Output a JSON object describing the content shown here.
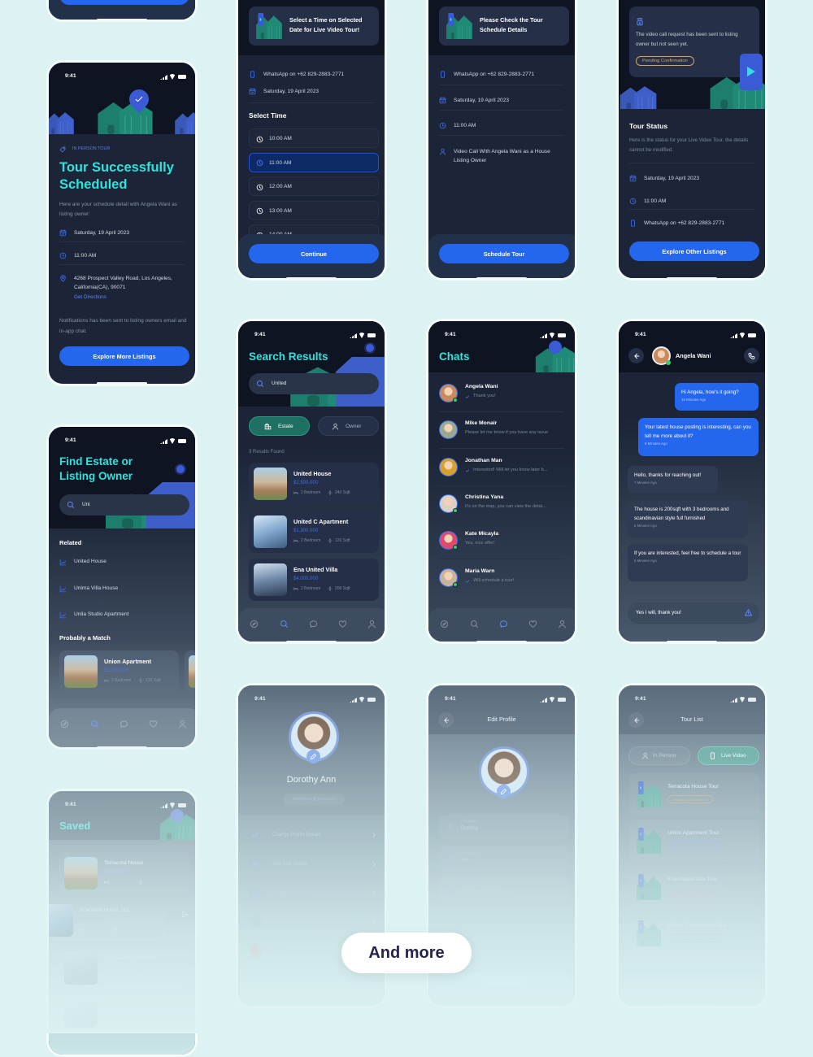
{
  "colors": {
    "background": "#dcf2f3",
    "accent_cyan": "#2ee3dc",
    "primary_blue": "#2566ee",
    "estate_green": "#1f6f62",
    "pending_orange": "#d9a35a",
    "dark_header": "#0e1422",
    "dark_body": "#1c2538"
  },
  "status_time": "9:41",
  "select_time": {
    "banner": "Select a Time on Selected Date for Live Video Tour!",
    "whatsapp": "WhatsApp on +62 829-2883-2771",
    "date": "Saturday, 19 April 2023",
    "section_title": "Select Time",
    "slots": [
      {
        "label": "10:00 AM",
        "selected": false
      },
      {
        "label": "11:00 AM",
        "selected": true
      },
      {
        "label": "12:00 AM",
        "selected": false
      },
      {
        "label": "13:00 AM",
        "selected": false
      },
      {
        "label": "14:00 AM",
        "selected": false
      }
    ],
    "button": "Continue"
  },
  "check_schedule": {
    "banner": "Please Check the Tour Schedule Details",
    "whatsapp": "WhatsApp on +62 829-2883-2771",
    "date": "Saturday, 19 April 2023",
    "time": "11:00 AM",
    "host": "Video Call With Angela Wani as a House Listing Owner",
    "button": "Schedule Tour"
  },
  "tour_status": {
    "notice": "The video call request has been sent to listing owner but not seen yet.",
    "pill": "Pending Confirmation",
    "title": "Tour Status",
    "desc": "Here is the status for your Live Video Tour, the details cannot be modified.",
    "date": "Saturday, 19 April 2023",
    "time": "11:00 AM",
    "whatsapp": "WhatsApp on +62 829-2883-2771",
    "button": "Explore Other Listings"
  },
  "tour_scheduled": {
    "tag": "IN PERSON TOUR",
    "title_1": "Tour Successfully",
    "title_2": "Scheduled",
    "desc": "Here are your schedule detail with Angela Wani as listing owner:",
    "date": "Saturday, 19 April 2023",
    "time": "11:00 AM",
    "address": "4268 Prospect Valley Road, Los Angeles, California(CA), 90071",
    "directions": "Get Directions",
    "notification": "Notifications has been sent to listing owners email and in-app chat.",
    "button": "Explore More Listings"
  },
  "search_results": {
    "title": "Search Results",
    "query": "United",
    "tabs": [
      {
        "label": "Estate",
        "active": true
      },
      {
        "label": "Owner",
        "active": false
      }
    ],
    "count": "3 Results Found",
    "results": [
      {
        "name": "United House",
        "price": "$2,500,000",
        "beds": "2 Bedroom",
        "area": "240 Sqft"
      },
      {
        "name": "United C Apartment",
        "price": "$1,300,000",
        "beds": "2 Bedroom",
        "area": "120 Sqft"
      },
      {
        "name": "Ena United Villa",
        "price": "$4,000,000",
        "beds": "2 Bedroom",
        "area": "200 Sqft"
      }
    ],
    "nav_active": "search"
  },
  "chats": {
    "title": "Chats",
    "items": [
      {
        "name": "Angela Wani",
        "message": "Thank you!",
        "read": true,
        "online": true,
        "avatar": "#c98a5e"
      },
      {
        "name": "Mike Monair",
        "message": "Please let me know if you have any issue",
        "read": false,
        "online": false,
        "avatar": "#9aa88f"
      },
      {
        "name": "Jonathan Man",
        "message": "Interested! Will let you know later b...",
        "read": true,
        "online": false,
        "avatar": "#d8a12e"
      },
      {
        "name": "Christina Yana",
        "message": "It's on the map, you can view the detai...",
        "read": false,
        "online": true,
        "avatar": "#d9d0c8"
      },
      {
        "name": "Kate Micayla",
        "message": "Yes, nice offer!",
        "read": false,
        "online": true,
        "avatar": "#e04a6a"
      },
      {
        "name": "Maria Warn",
        "message": "Will schedule a tour!",
        "read": true,
        "online": true,
        "avatar": "#c8b39a"
      }
    ],
    "nav_active": "chat"
  },
  "conversation": {
    "contact": "Angela Wani",
    "messages": [
      {
        "text": "Hi Angela, how's it going?",
        "time": "10 Minutes Ago",
        "mine": true
      },
      {
        "text": "Your latest house posting is interesting, can you tell me more about it?",
        "time": "8 Minutes Ago",
        "mine": true
      },
      {
        "text": "Hello, thanks for reaching out!",
        "time": "7 Minutes Ago",
        "mine": false
      },
      {
        "text": "The house is 200sqft with 3 bedrooms and scandinavian style full furnished",
        "time": "6 Minutes Ago",
        "mine": false
      },
      {
        "text": "If you are interested, feel free to schedule a tour",
        "time": "6 Minutes Ago",
        "mine": false
      }
    ],
    "input_value": "Yes I will, thank you!"
  },
  "find": {
    "title_1": "Find Estate or",
    "title_2": "Listing Owner",
    "query": "Uni",
    "related_title": "Related",
    "related": [
      "United House",
      "Unima Villa House",
      "Unila Studio Apartment"
    ],
    "match_title": "Probably a Match",
    "match": {
      "name": "Union Apartment",
      "price": "$1,200,000",
      "beds": "2 Bedroom",
      "area": "120 Sqft"
    },
    "nav_active": "search"
  },
  "profile": {
    "name": "Dorothy Ann",
    "email": "dorothyann@gmail.com",
    "menu": [
      {
        "label": "Change Profile Details",
        "icon": "pencil"
      },
      {
        "label": "See Tour Status",
        "icon": "tour"
      },
      {
        "label": "Change Password",
        "icon": "lock"
      },
      {
        "label": "Display and Notification Settings",
        "icon": "gear"
      },
      {
        "label": "Logout",
        "icon": "logout"
      }
    ]
  },
  "edit_profile": {
    "title": "Edit Profile",
    "fields": [
      {
        "label": "First Name",
        "value": "Dorothy",
        "icon": "user"
      },
      {
        "label": "Last Name",
        "value": "Ann",
        "icon": "user"
      },
      {
        "label": "Email Address",
        "value": "dorothyann@gmail.com",
        "icon": "mail"
      }
    ],
    "button": "Save Changes"
  },
  "tour_list": {
    "title": "Tour List",
    "tabs": [
      {
        "label": "In Person",
        "active": false
      },
      {
        "label": "Live Video",
        "active": true
      }
    ],
    "tours": [
      {
        "name": "Terracota House Tour",
        "status": "Pending Confirmation",
        "color": "#d9a35a"
      },
      {
        "name": "Union Apartment Tour",
        "status": "Confirmed by Listing Owner",
        "color": "#6b8ff0"
      },
      {
        "name": "Ena United Villa Tour",
        "status": "Canceled by Listing Owner",
        "color": "#e08a8a"
      },
      {
        "name": "United C Apartment Tour",
        "status": "Confirmed by Listing Owner",
        "color": "#6b8ff0"
      }
    ]
  },
  "saved": {
    "title": "Saved",
    "items": [
      {
        "name": "Terracota House"
      },
      {
        "name": "Scandina House 101"
      },
      {
        "name": "Eco Studio Apartment"
      }
    ]
  },
  "and_more": "And more"
}
